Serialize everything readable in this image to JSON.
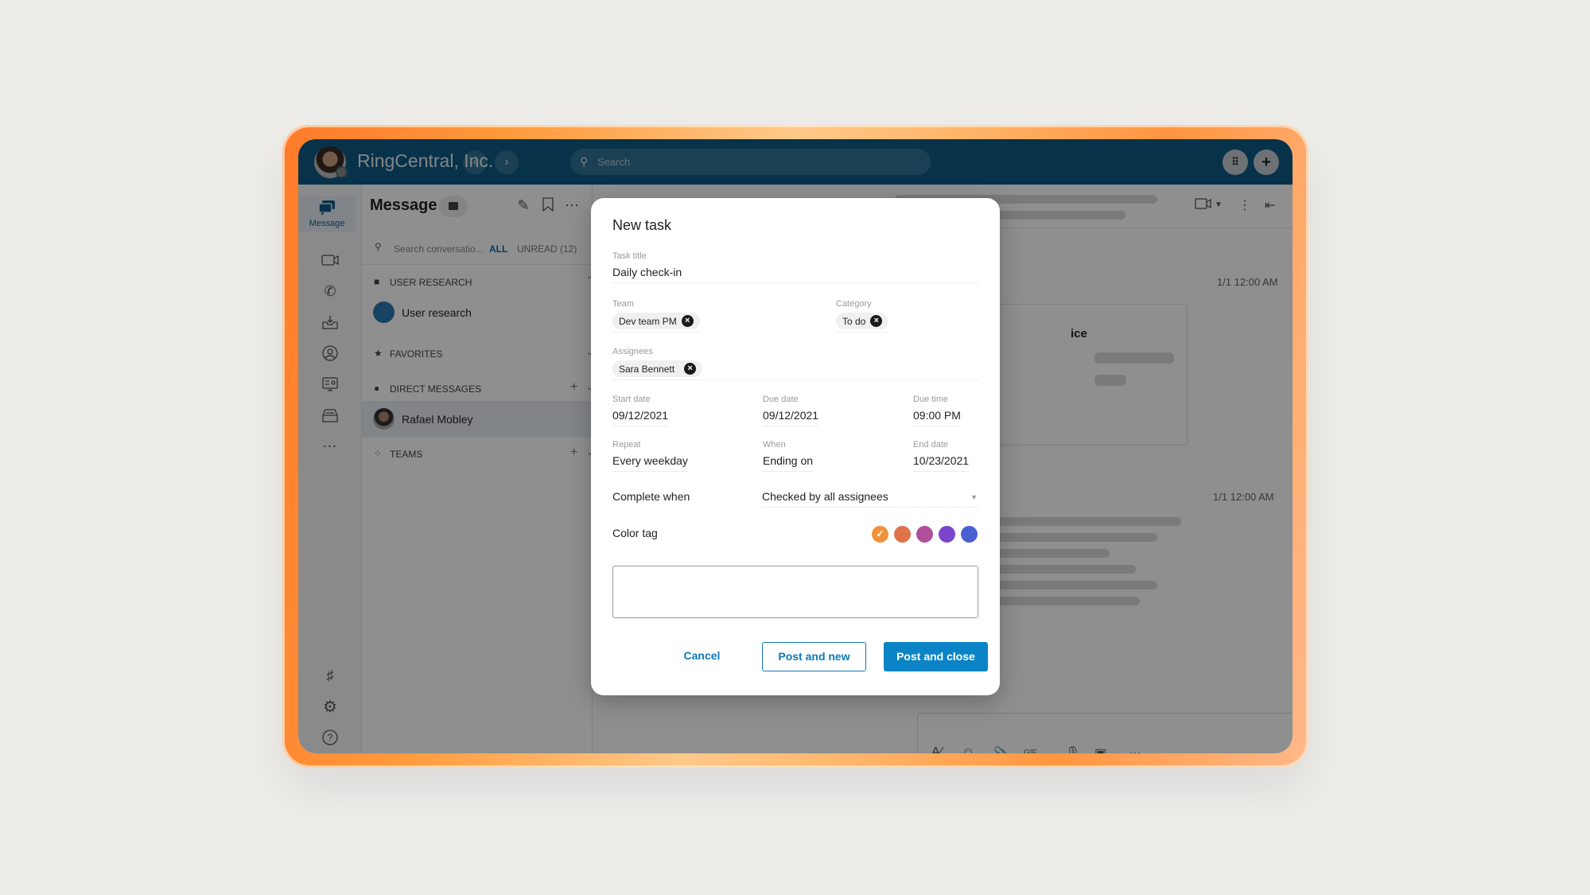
{
  "app": {
    "title": "RingCentral, Inc.",
    "search_placeholder": "Search",
    "back_label": "‹",
    "forward_label": "›",
    "dialpad_icon": "⠿",
    "add_label": "+"
  },
  "rail": {
    "active_label": "Message",
    "items": [
      "message",
      "video",
      "phone",
      "inbox",
      "contacts",
      "rooms",
      "fax",
      "more",
      "apps",
      "settings",
      "help"
    ]
  },
  "left_panel": {
    "title": "Message",
    "search_placeholder": "Search conversatio...",
    "filter_all": "ALL",
    "filter_unread": "UNREAD (12)",
    "sections": [
      {
        "label": "USER RESEARCH"
      },
      {
        "label": "FAVORITES"
      },
      {
        "label": "DIRECT MESSAGES"
      },
      {
        "label": "TEAMS"
      }
    ],
    "items": [
      {
        "name": "User research"
      },
      {
        "name": "Rafael Mobley"
      }
    ]
  },
  "content": {
    "timestamps": [
      "1/1 12:00 AM",
      "1/1 12:00 AM"
    ],
    "card_title_fragment": "ice"
  },
  "dialog": {
    "title": "New task",
    "task_title_label": "Task title",
    "task_title_value": "Daily check-in",
    "team_label": "Team",
    "team_chip": "Dev team PM",
    "category_label": "Category",
    "category_chip": "To do",
    "assignees_label": "Assignees",
    "assignee_chip": "Sara Bennett",
    "start_date_label": "Start date",
    "start_date_value": "09/12/2021",
    "due_date_label": "Due date",
    "due_date_value": "09/12/2021",
    "due_time_label": "Due time",
    "due_time_value": "09:00 PM",
    "repeat_label": "Repeat",
    "repeat_value": "Every weekday",
    "when_label": "When",
    "when_value": "Ending on",
    "end_date_label": "End date",
    "end_date_value": "10/23/2021",
    "complete_when_label": "Complete when",
    "complete_when_value": "Checked by all assignees",
    "color_tag_label": "Color tag",
    "color_tags": [
      {
        "color": "#f0923a",
        "selected": true
      },
      {
        "color": "#e0734a",
        "selected": false
      },
      {
        "color": "#b0509a",
        "selected": false
      },
      {
        "color": "#7a44cc",
        "selected": false
      },
      {
        "color": "#4a5fd0",
        "selected": false
      }
    ],
    "note_value": "",
    "cancel_label": "Cancel",
    "post_new_label": "Post and new",
    "post_close_label": "Post and close"
  },
  "colors": {
    "brand_header": "#0d5a85",
    "primary_button": "#0a84c6",
    "link": "#0d7ab8"
  }
}
